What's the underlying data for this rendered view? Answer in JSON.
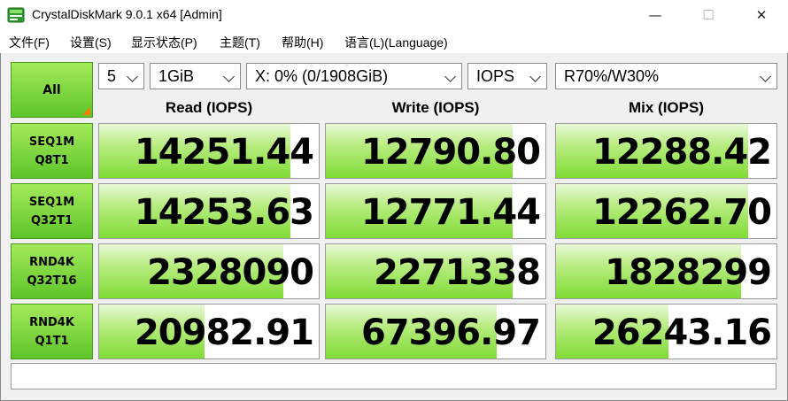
{
  "window": {
    "title": "CrystalDiskMark 9.0.1 x64 [Admin]",
    "minimize_glyph": "—",
    "maximize_glyph": "☐",
    "close_glyph": "✕"
  },
  "menu": [
    "文件(F)",
    "设置(S)",
    "显示状态(P)",
    "主题(T)",
    "帮助(H)",
    "语言(L)(Language)"
  ],
  "controls": {
    "all_label": "All",
    "count": "5",
    "size": "1GiB",
    "drive": "X: 0% (0/1908GiB)",
    "unit": "IOPS",
    "mix": "R70%/W30%"
  },
  "columns": [
    "Read (IOPS)",
    "Write (IOPS)",
    "Mix (IOPS)"
  ],
  "rows": [
    {
      "line1": "SEQ1M",
      "line2": "Q8T1",
      "read": "14251.44",
      "write": "12790.80",
      "mix": "12288.42",
      "read_fill": 0.87,
      "write_fill": 0.85,
      "mix_fill": 0.87
    },
    {
      "line1": "SEQ1M",
      "line2": "Q32T1",
      "read": "14253.63",
      "write": "12771.44",
      "mix": "12262.70",
      "read_fill": 0.87,
      "write_fill": 0.85,
      "mix_fill": 0.87
    },
    {
      "line1": "RND4K",
      "line2": "Q32T16",
      "read": "2328090",
      "write": "2271338",
      "mix": "1828299",
      "read_fill": 0.84,
      "write_fill": 0.85,
      "mix_fill": 0.84
    },
    {
      "line1": "RND4K",
      "line2": "Q1T1",
      "read": "20982.91",
      "write": "67396.97",
      "mix": "26243.16",
      "read_fill": 0.48,
      "write_fill": 0.78,
      "mix_fill": 0.51
    }
  ],
  "status_text": "",
  "colors": {
    "accent_green": "#7fdb35",
    "corner_orange": "#ff7a00"
  }
}
